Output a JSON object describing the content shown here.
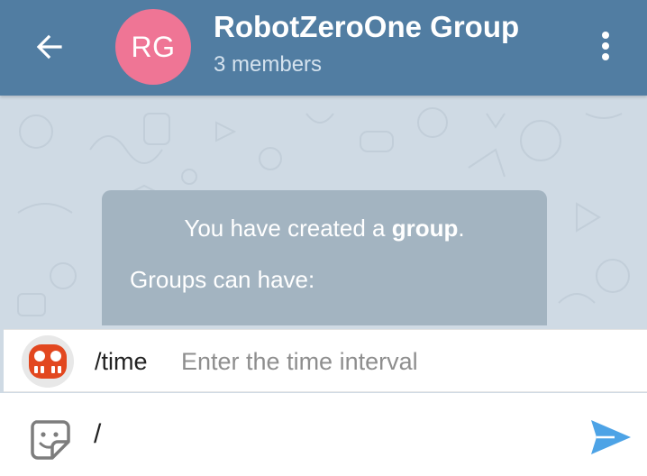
{
  "header": {
    "avatar_initials": "RG",
    "title": "RobotZeroOne Group",
    "subtitle": "3 members",
    "colors": {
      "bar": "#517da2",
      "avatar": "#ef7595"
    },
    "icons": {
      "back": "arrow-left-icon",
      "menu": "more-vertical-icon"
    }
  },
  "chat": {
    "service_message": {
      "line1_prefix": "You have created a ",
      "line1_bold": "group",
      "line1_suffix": ".",
      "line2": "Groups can have:"
    }
  },
  "command_suggestion": {
    "bot_icon": "robot-icon",
    "command": "/time",
    "description": "Enter the time interval"
  },
  "composer": {
    "input_value": "/",
    "sticker_icon": "sticker-icon",
    "send_icon": "send-icon",
    "send_color": "#4da3e6"
  }
}
